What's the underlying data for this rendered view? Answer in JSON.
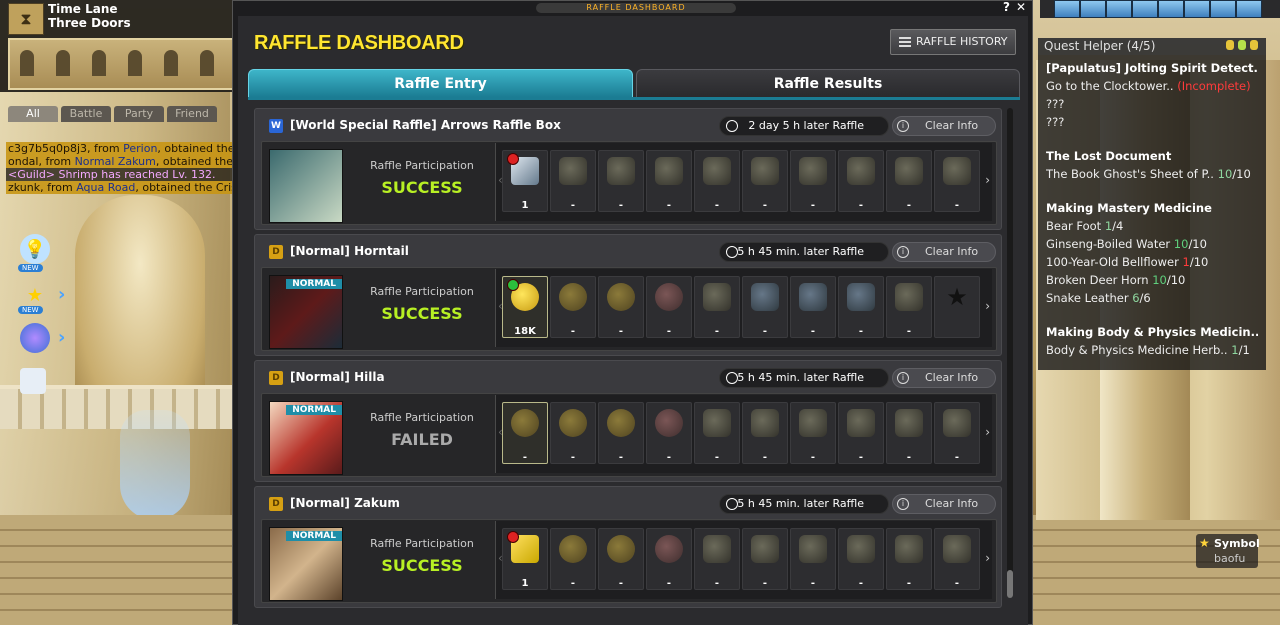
{
  "map": {
    "region": "Time Lane",
    "name": "Three Doors"
  },
  "chat": {
    "tabs": [
      "All",
      "Battle",
      "Party",
      "Friend"
    ],
    "lines": [
      {
        "pre": "c3g7b5q0p8j3, from ",
        "where": "Perion",
        "post": ", obtained the F"
      },
      {
        "pre": "ondal, from ",
        "where": "Normal Zakum",
        "post": ", obtained the I"
      },
      {
        "guild": "<Guild> Shrimp has reached Lv. 132."
      },
      {
        "pre": "zkunk, from ",
        "where": "Aqua Road",
        "post": ", obtained the Crisp"
      }
    ]
  },
  "side": {
    "new1": "NEW",
    "new2": "NEW"
  },
  "window": {
    "titlebar": "RAFFLE DASHBOARD",
    "help": "?",
    "close": "✕",
    "title": "RAFFLE DASHBOARD",
    "history_button": "RAFFLE HISTORY",
    "tabs": {
      "entry": "Raffle Entry",
      "results": "Raffle Results"
    }
  },
  "raffles": [
    {
      "badge": "W",
      "badge_type": "w",
      "name": "[World Special Raffle] Arrows Raffle Box",
      "timer": "2 day 5 h later Raffle",
      "clear": "Clear Info",
      "participation": "Raffle Participation",
      "result": "SUCCESS",
      "result_type": "success",
      "label": "",
      "items": [
        {
          "icon": "box",
          "qty": "1",
          "burst": true
        },
        {
          "icon": "gear",
          "qty": "-"
        },
        {
          "icon": "gear",
          "qty": "-"
        },
        {
          "icon": "gear",
          "qty": "-"
        },
        {
          "icon": "gear",
          "qty": "-"
        },
        {
          "icon": "gear",
          "qty": "-"
        },
        {
          "icon": "gear",
          "qty": "-"
        },
        {
          "icon": "gear",
          "qty": "-"
        },
        {
          "icon": "gear",
          "qty": "-"
        },
        {
          "icon": "gear",
          "qty": "-"
        }
      ]
    },
    {
      "badge": "D",
      "badge_type": "n",
      "name": "[Normal] Horntail",
      "timer": "5 h 45 min. later Raffle",
      "clear": "Clear Info",
      "participation": "Raffle Participation",
      "result": "SUCCESS",
      "result_type": "success",
      "label": "NORMAL",
      "items": [
        {
          "icon": "coin-bright",
          "qty": "18K",
          "active": true,
          "plus": true
        },
        {
          "icon": "coin",
          "qty": "-"
        },
        {
          "icon": "coin",
          "qty": "-"
        },
        {
          "icon": "pink",
          "qty": "-"
        },
        {
          "icon": "gear",
          "qty": "-"
        },
        {
          "icon": "blue",
          "qty": "-"
        },
        {
          "icon": "blue",
          "qty": "-"
        },
        {
          "icon": "blue",
          "qty": "-"
        },
        {
          "icon": "gear",
          "qty": "-"
        },
        {
          "icon": "star",
          "qty": ""
        }
      ]
    },
    {
      "badge": "D",
      "badge_type": "n",
      "name": "[Normal] Hilla",
      "timer": "5 h 45 min. later Raffle",
      "clear": "Clear Info",
      "participation": "Raffle Participation",
      "result": "FAILED",
      "result_type": "failed",
      "label": "NORMAL",
      "items": [
        {
          "icon": "coin",
          "qty": "-",
          "active": true
        },
        {
          "icon": "coin",
          "qty": "-"
        },
        {
          "icon": "coin",
          "qty": "-"
        },
        {
          "icon": "pink",
          "qty": "-"
        },
        {
          "icon": "gear",
          "qty": "-"
        },
        {
          "icon": "gear",
          "qty": "-"
        },
        {
          "icon": "gear",
          "qty": "-"
        },
        {
          "icon": "gear",
          "qty": "-"
        },
        {
          "icon": "gear",
          "qty": "-"
        },
        {
          "icon": "gear",
          "qty": "-"
        }
      ]
    },
    {
      "badge": "D",
      "badge_type": "n",
      "name": "[Normal] Zakum",
      "timer": "5 h 45 min. later Raffle",
      "clear": "Clear Info",
      "participation": "Raffle Participation",
      "result": "SUCCESS",
      "result_type": "success",
      "label": "NORMAL",
      "items": [
        {
          "icon": "weapon",
          "qty": "1",
          "burst": true
        },
        {
          "icon": "coin",
          "qty": "-"
        },
        {
          "icon": "coin",
          "qty": "-"
        },
        {
          "icon": "pink",
          "qty": "-"
        },
        {
          "icon": "gear",
          "qty": "-"
        },
        {
          "icon": "gear",
          "qty": "-"
        },
        {
          "icon": "gear",
          "qty": "-"
        },
        {
          "icon": "gear",
          "qty": "-"
        },
        {
          "icon": "gear",
          "qty": "-"
        },
        {
          "icon": "gear",
          "qty": "-"
        }
      ]
    }
  ],
  "quest_helper": {
    "title": "Quest Helper (4/5)",
    "quests": [
      {
        "name": "[Papulatus] Jolting Spirit Detect..",
        "lines": [
          {
            "text": "Go to the Clocktower..",
            "status": "(Incomplete)"
          },
          {
            "text": "???"
          },
          {
            "text": "???"
          }
        ]
      },
      {
        "name": "The Lost Document",
        "lines": [
          {
            "text": "The Book Ghost's Sheet of P..",
            "have": "10",
            "need": "/10"
          }
        ]
      },
      {
        "name": "Making Mastery Medicine",
        "lines": [
          {
            "text": "Bear Foot",
            "have": "1",
            "need": "/4"
          },
          {
            "text": "Ginseng-Boiled Water",
            "have": "10",
            "need": "/10"
          },
          {
            "text": "100-Year-Old Bellflower",
            "have": "1",
            "need": "/10"
          },
          {
            "text": "Broken Deer Horn",
            "have": "10",
            "need": "/10"
          },
          {
            "text": "Snake Leather",
            "have": "6",
            "need": "/6"
          }
        ]
      },
      {
        "name": "Making Body & Physics Medicin..",
        "lines": [
          {
            "text": "Body & Physics Medicine Herb..",
            "have": "1",
            "need": "/1"
          }
        ]
      }
    ]
  },
  "symbol": {
    "label": "Symbol",
    "user": "baofu"
  },
  "colors": {
    "accent": "#1b7c93",
    "title_yellow": "#ffe630",
    "success": "#b8f024"
  }
}
